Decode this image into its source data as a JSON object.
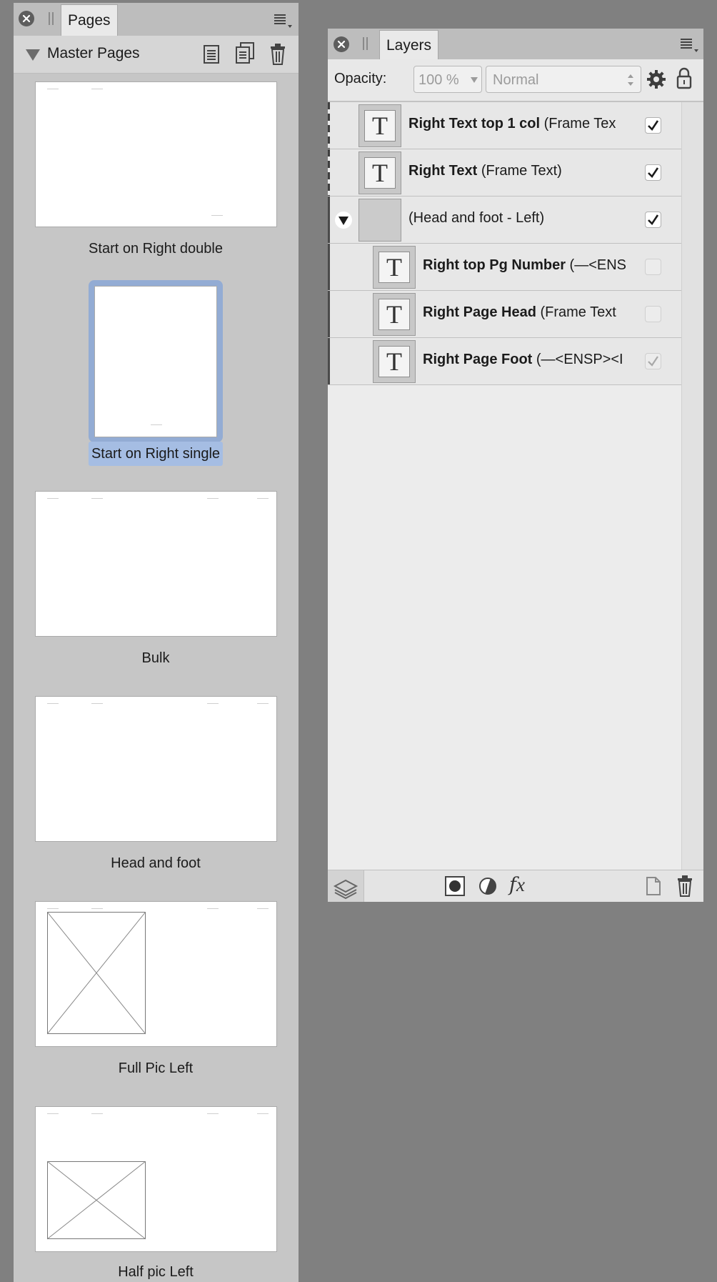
{
  "pages_panel": {
    "tab_label": "Pages",
    "section_title": "Master Pages",
    "thumbnails": [
      {
        "caption": "Start on Right double"
      },
      {
        "caption": "Start on Right single",
        "selected": true
      },
      {
        "caption": "Bulk"
      },
      {
        "caption": "Head and foot"
      },
      {
        "caption": "Full Pic Left"
      },
      {
        "caption": "Half pic Left"
      }
    ]
  },
  "layers_panel": {
    "tab_label": "Layers",
    "opacity_label": "Opacity:",
    "opacity_value": "100 %",
    "blend_mode": "Normal",
    "layers": [
      {
        "name_bold": "Right Text top 1 col",
        "name_rest": " (Frame Tex",
        "visible": true
      },
      {
        "name_bold": "Right Text",
        "name_rest": " (Frame Text)",
        "visible": true
      },
      {
        "name_bold": "",
        "name_rest": "(Head and foot - Left)",
        "visible": true
      },
      {
        "name_bold": "Right top Pg Number",
        "name_rest": " (—<ENS",
        "visible": false
      },
      {
        "name_bold": "Right Page Head",
        "name_rest": " (Frame Text",
        "visible": false
      },
      {
        "name_bold": "Right Page Foot",
        "name_rest": " (—<ENSP><I",
        "visible": true
      }
    ]
  },
  "colors": {
    "selection_blue": "#93acd4",
    "panel_gray": "#c6c6c6",
    "background": "#808080"
  }
}
